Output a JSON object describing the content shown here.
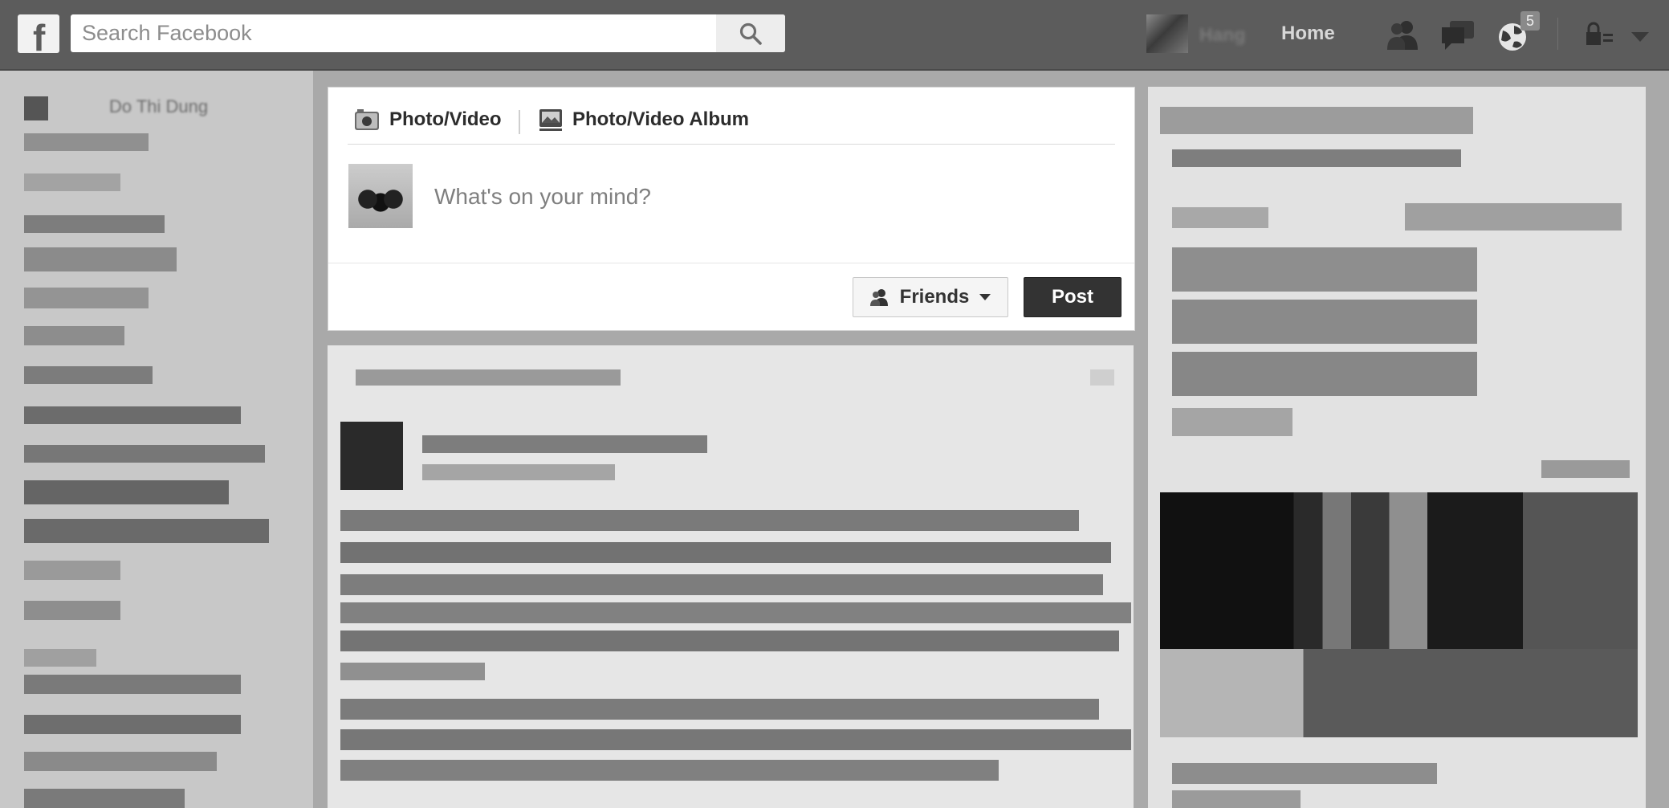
{
  "topbar": {
    "logo": "f",
    "search_placeholder": "Search Facebook",
    "user_name": "Hang",
    "home_label": "Home",
    "notification_count": "5"
  },
  "left_sidebar": {
    "profile_name": "Do Thi Dung"
  },
  "composer": {
    "tab_photo_video": "Photo/Video",
    "tab_photo_album": "Photo/Video Album",
    "placeholder": "What's on your mind?",
    "audience_label": "Friends",
    "post_label": "Post"
  },
  "icons": {
    "search": "search-icon",
    "friend_requests": "friend-requests-icon",
    "messages": "messages-icon",
    "notifications": "globe-icon",
    "privacy": "lock-icon",
    "account_menu": "chevron-down-icon",
    "camera": "camera-icon",
    "album": "album-icon",
    "audience": "friends-icon",
    "dropdown": "caret-down-icon"
  },
  "colors": {
    "topbar": "#5c5c5c",
    "post_button": "#333333",
    "page_background": "#a9a9a9"
  }
}
